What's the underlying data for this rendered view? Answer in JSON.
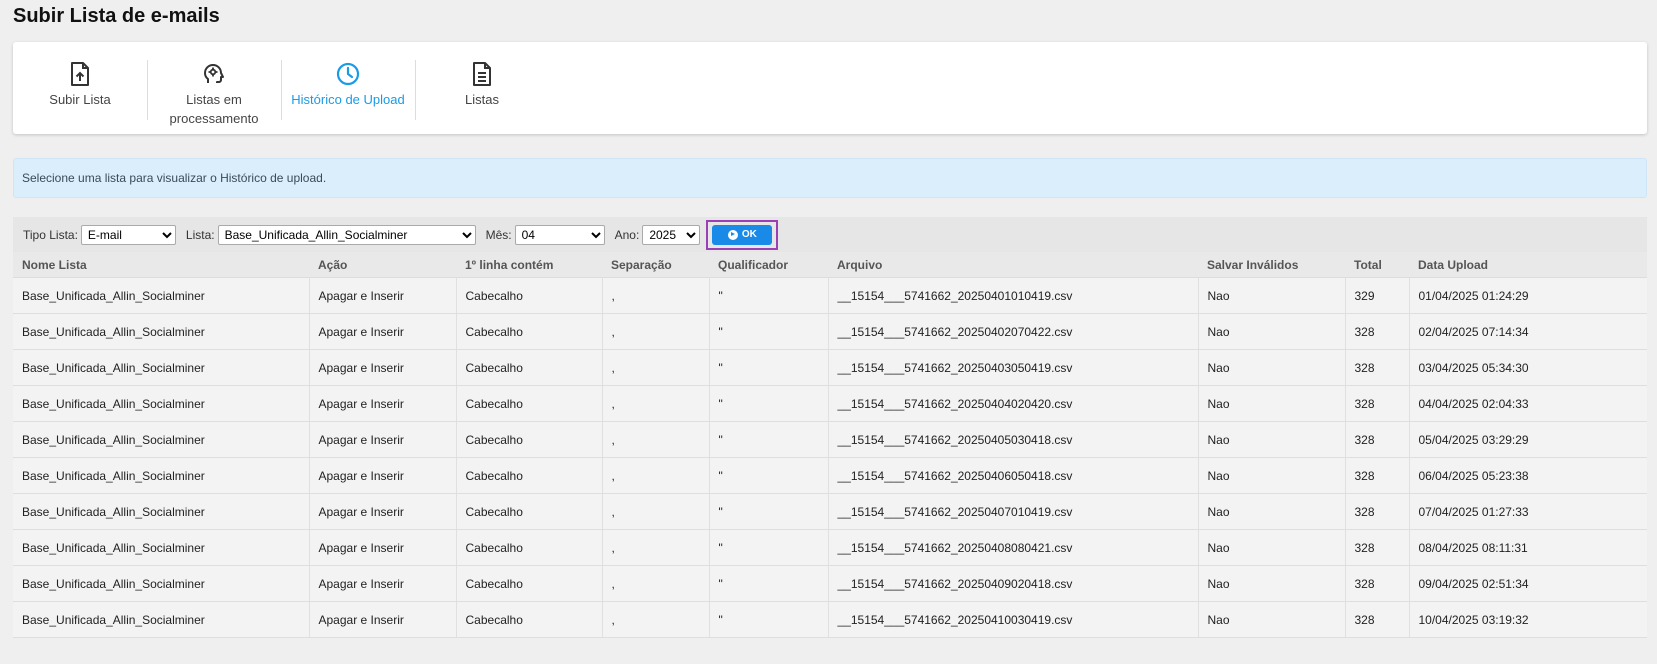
{
  "page": {
    "title": "Subir Lista de e-mails"
  },
  "tabs": [
    {
      "label": "Subir Lista",
      "icon": "file-upload-icon",
      "active": false
    },
    {
      "label": "Listas em processamento",
      "icon": "gear-head-icon",
      "active": false
    },
    {
      "label": "Histórico de Upload",
      "icon": "clock-icon",
      "active": true
    },
    {
      "label": "Listas",
      "icon": "document-list-icon",
      "active": false
    }
  ],
  "info": {
    "message": "Selecione uma lista para visualizar o Histórico de upload."
  },
  "filters": {
    "tipo_label": "Tipo Lista:",
    "tipo_value": "E-mail",
    "lista_label": "Lista:",
    "lista_value": "Base_Unificada_Allin_Socialminer",
    "mes_label": "Mês:",
    "mes_value": "04",
    "ano_label": "Ano:",
    "ano_value": "2025",
    "ok_label": "OK"
  },
  "colors": {
    "accent": "#1a9be6",
    "highlight_border": "#9b3fb5",
    "info_bg": "#dbeefc"
  },
  "table": {
    "columns": [
      "Nome Lista",
      "Ação",
      "1º linha contém",
      "Separação",
      "Qualificador",
      "Arquivo",
      "Salvar Inválidos",
      "Total",
      "Data Upload"
    ],
    "rows": [
      [
        "Base_Unificada_Allin_Socialminer",
        "Apagar e Inserir",
        "Cabecalho",
        ",",
        "\"",
        "__15154___5741662_20250401010419.csv",
        "Nao",
        "329",
        "01/04/2025 01:24:29"
      ],
      [
        "Base_Unificada_Allin_Socialminer",
        "Apagar e Inserir",
        "Cabecalho",
        ",",
        "\"",
        "__15154___5741662_20250402070422.csv",
        "Nao",
        "328",
        "02/04/2025 07:14:34"
      ],
      [
        "Base_Unificada_Allin_Socialminer",
        "Apagar e Inserir",
        "Cabecalho",
        ",",
        "\"",
        "__15154___5741662_20250403050419.csv",
        "Nao",
        "328",
        "03/04/2025 05:34:30"
      ],
      [
        "Base_Unificada_Allin_Socialminer",
        "Apagar e Inserir",
        "Cabecalho",
        ",",
        "\"",
        "__15154___5741662_20250404020420.csv",
        "Nao",
        "328",
        "04/04/2025 02:04:33"
      ],
      [
        "Base_Unificada_Allin_Socialminer",
        "Apagar e Inserir",
        "Cabecalho",
        ",",
        "\"",
        "__15154___5741662_20250405030418.csv",
        "Nao",
        "328",
        "05/04/2025 03:29:29"
      ],
      [
        "Base_Unificada_Allin_Socialminer",
        "Apagar e Inserir",
        "Cabecalho",
        ",",
        "\"",
        "__15154___5741662_20250406050418.csv",
        "Nao",
        "328",
        "06/04/2025 05:23:38"
      ],
      [
        "Base_Unificada_Allin_Socialminer",
        "Apagar e Inserir",
        "Cabecalho",
        ",",
        "\"",
        "__15154___5741662_20250407010419.csv",
        "Nao",
        "328",
        "07/04/2025 01:27:33"
      ],
      [
        "Base_Unificada_Allin_Socialminer",
        "Apagar e Inserir",
        "Cabecalho",
        ",",
        "\"",
        "__15154___5741662_20250408080421.csv",
        "Nao",
        "328",
        "08/04/2025 08:11:31"
      ],
      [
        "Base_Unificada_Allin_Socialminer",
        "Apagar e Inserir",
        "Cabecalho",
        ",",
        "\"",
        "__15154___5741662_20250409020418.csv",
        "Nao",
        "328",
        "09/04/2025 02:51:34"
      ],
      [
        "Base_Unificada_Allin_Socialminer",
        "Apagar e Inserir",
        "Cabecalho",
        ",",
        "\"",
        "__15154___5741662_20250410030419.csv",
        "Nao",
        "328",
        "10/04/2025 03:19:32"
      ]
    ]
  }
}
